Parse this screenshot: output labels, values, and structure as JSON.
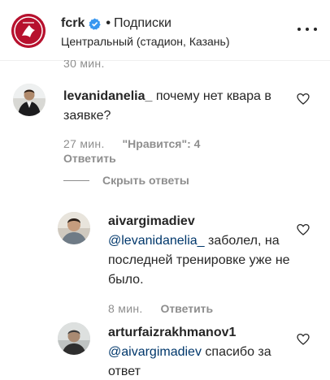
{
  "header": {
    "account_name": "fcrk",
    "separator": "•",
    "follow_status": "Подписки",
    "location": "Центральный (стадион, Казань)",
    "logo_text": "РУБИН"
  },
  "cut_time": "30 мин.",
  "comment": {
    "username": "levanidanelia_",
    "text": "почему нет квара в заявке?",
    "time": "27 мин.",
    "likes": "\"Нравится\": 4",
    "reply_label": "Ответить"
  },
  "hide_replies_label": "Скрыть ответы",
  "replies": [
    {
      "username": "aivargimadiev",
      "mention": "@levanidanelia_",
      "text": "заболел, на последней тренировке уже не было.",
      "time": "8 мин.",
      "reply_label": "Ответить"
    },
    {
      "username": "arturfaizrakhmanov1",
      "mention": "@aivargimadiev",
      "text": "спасибо за ответ"
    }
  ],
  "colors": {
    "text": "#262626",
    "secondary": "#8e8e8e",
    "mention": "#00376b",
    "verified": "#3897f0",
    "brand": "#b7112e"
  }
}
